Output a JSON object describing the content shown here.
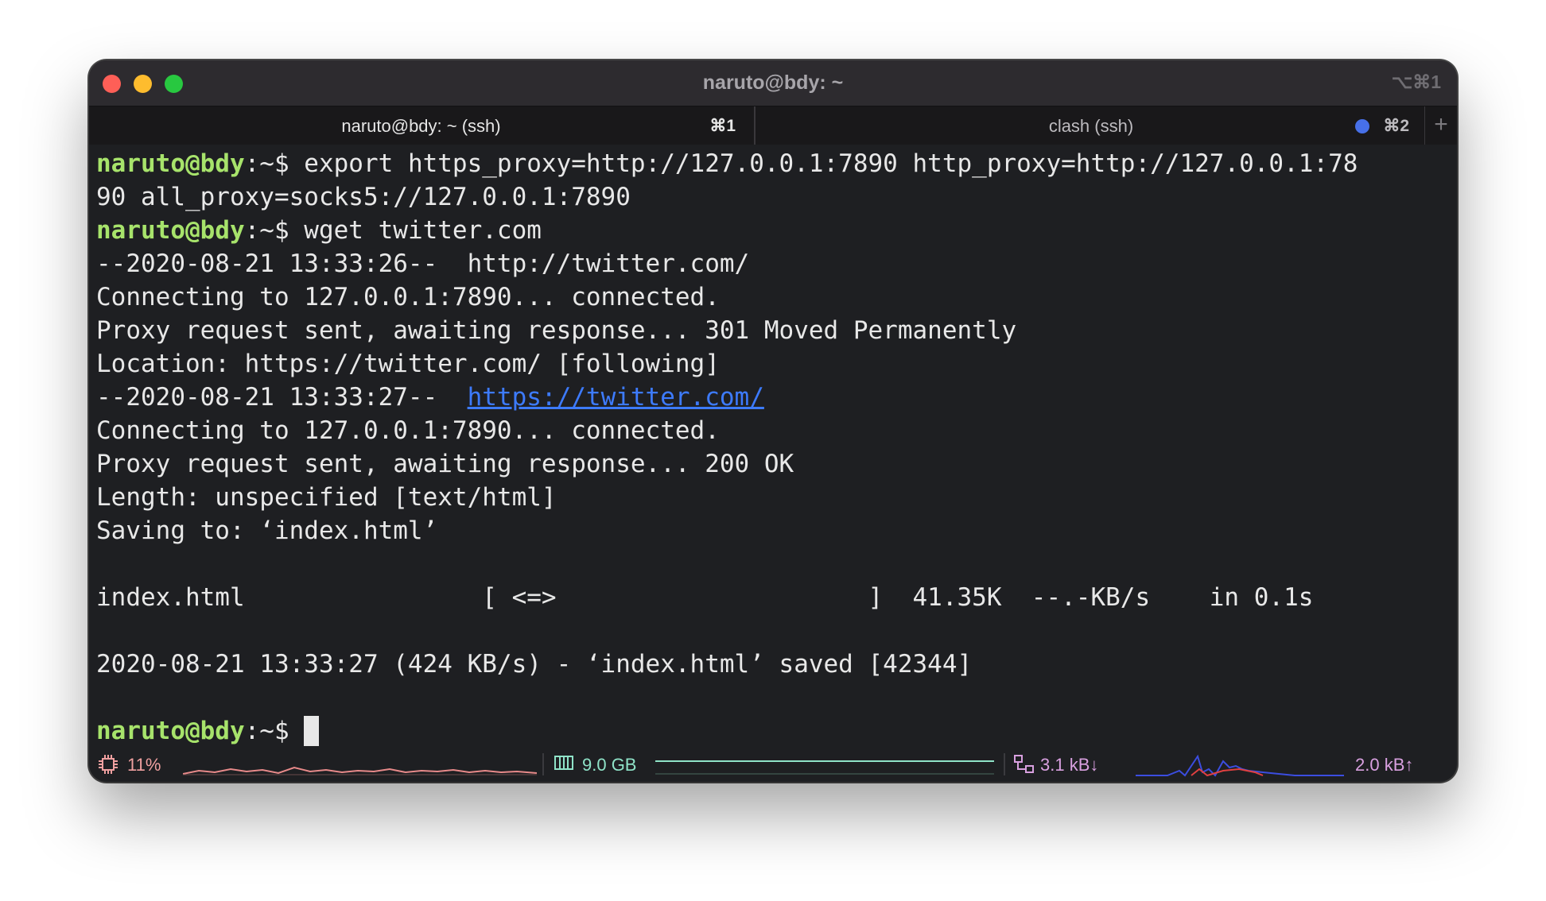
{
  "window": {
    "title": "naruto@bdy: ~",
    "shortcut": "⌥⌘1"
  },
  "tabs": [
    {
      "label": "naruto@bdy: ~ (ssh)",
      "shortcut": "⌘1",
      "active": true
    },
    {
      "label": "clash (ssh)",
      "shortcut": "⌘2",
      "active": false,
      "indicator_color": "#4770e8"
    }
  ],
  "new_tab_icon": "plus-icon",
  "terminal": {
    "prompt_user": "naruto@bdy",
    "prompt_suffix": ":~$ ",
    "lines": [
      {
        "prompt": true,
        "text": "export https_proxy=http://127.0.0.1:7890 http_proxy=http://127.0.0.1:78"
      },
      {
        "text": "90 all_proxy=socks5://127.0.0.1:7890"
      },
      {
        "prompt": true,
        "text": "wget twitter.com"
      },
      {
        "text": "--2020-08-21 13:33:26--  http://twitter.com/"
      },
      {
        "text": "Connecting to 127.0.0.1:7890... connected."
      },
      {
        "text": "Proxy request sent, awaiting response... 301 Moved Permanently"
      },
      {
        "text": "Location: https://twitter.com/ [following]"
      },
      {
        "text": "--2020-08-21 13:33:27--  ",
        "link": "https://twitter.com/"
      },
      {
        "text": "Connecting to 127.0.0.1:7890... connected."
      },
      {
        "text": "Proxy request sent, awaiting response... 200 OK"
      },
      {
        "text": "Length: unspecified [text/html]"
      },
      {
        "text": "Saving to: ‘index.html’"
      },
      {
        "text": ""
      },
      {
        "text": "index.html                [ <=>                     ]  41.35K  --.-KB/s    in 0.1s"
      },
      {
        "text": ""
      },
      {
        "text": "2020-08-21 13:33:27 (424 KB/s) - ‘index.html’ saved [42344]"
      },
      {
        "text": ""
      },
      {
        "prompt": true,
        "text": "",
        "cursor": true
      }
    ]
  },
  "status": {
    "cpu": {
      "icon": "cpu-icon",
      "value": "11%",
      "color": "#f0a0a0"
    },
    "memory": {
      "icon": "memory-icon",
      "value": "9.0 GB",
      "color": "#8fe3c8"
    },
    "network": {
      "icon": "network-icon",
      "down": "3.1 kB↓",
      "up": "2.0 kB↑",
      "color": "#d9a0e0"
    }
  },
  "colors": {
    "window_bg": "#1e1f22",
    "prompt": "#a7e36b",
    "link": "#3d7bff"
  }
}
